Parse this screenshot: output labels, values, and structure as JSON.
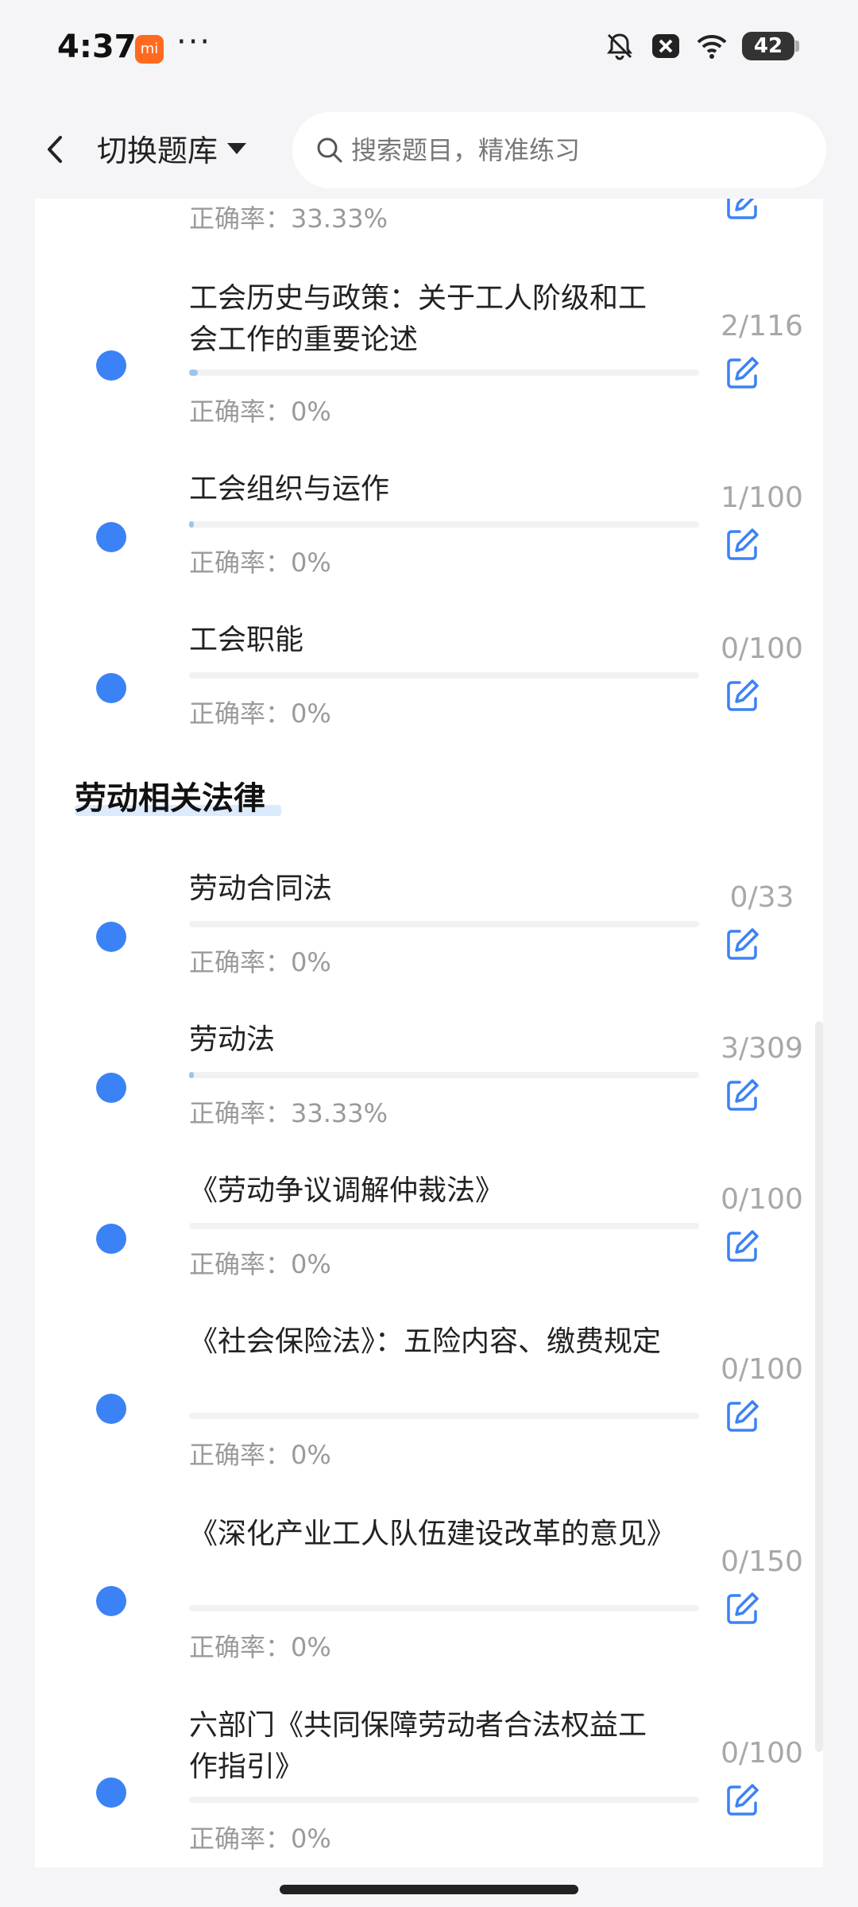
{
  "status_bar": {
    "time": "4:37",
    "app_icon_label": "mi",
    "more": "···",
    "battery": "42",
    "icons": [
      "mute-bell-icon",
      "close-box-icon",
      "wifi-icon"
    ]
  },
  "header": {
    "switch_label": "切换题库",
    "search_placeholder": "搜索题目，精准练习"
  },
  "partial_item": {
    "accuracy": "正确率：33.33%"
  },
  "section_label": "劳动相关法律",
  "items": [
    {
      "title": "工会历史与政策：关于工人阶级和工会工作的重要论述",
      "progress": "2/116",
      "accuracy": "正确率：0%",
      "fraction": 0.017
    },
    {
      "title": "工会组织与运作",
      "progress": "1/100",
      "accuracy": "正确率：0%",
      "fraction": 0.01
    },
    {
      "title": "工会职能",
      "progress": "0/100",
      "accuracy": "正确率：0%",
      "fraction": 0
    },
    {
      "title": "劳动合同法",
      "progress": "0/33",
      "accuracy": "正确率：0%",
      "fraction": 0
    },
    {
      "title": "劳动法",
      "progress": "3/309",
      "accuracy": "正确率：33.33%",
      "fraction": 0.0097
    },
    {
      "title": "《劳动争议调解仲裁法》",
      "progress": "0/100",
      "accuracy": "正确率：0%",
      "fraction": 0
    },
    {
      "title": "《社会保险法》：五险内容、缴费规定",
      "progress": "0/100",
      "accuracy": "正确率：0%",
      "fraction": 0
    },
    {
      "title": "《深化产业工人队伍建设改革的意见》",
      "progress": "0/150",
      "accuracy": "正确率：0%",
      "fraction": 0
    },
    {
      "title": "六部门《共同保障劳动者合法权益工作指引》",
      "progress": "0/100",
      "accuracy": "正确率：0%",
      "fraction": 0
    }
  ],
  "colors": {
    "accent": "#3b82f6",
    "progress_fill": "#9fc4ea",
    "muted": "#9a9a9a"
  }
}
